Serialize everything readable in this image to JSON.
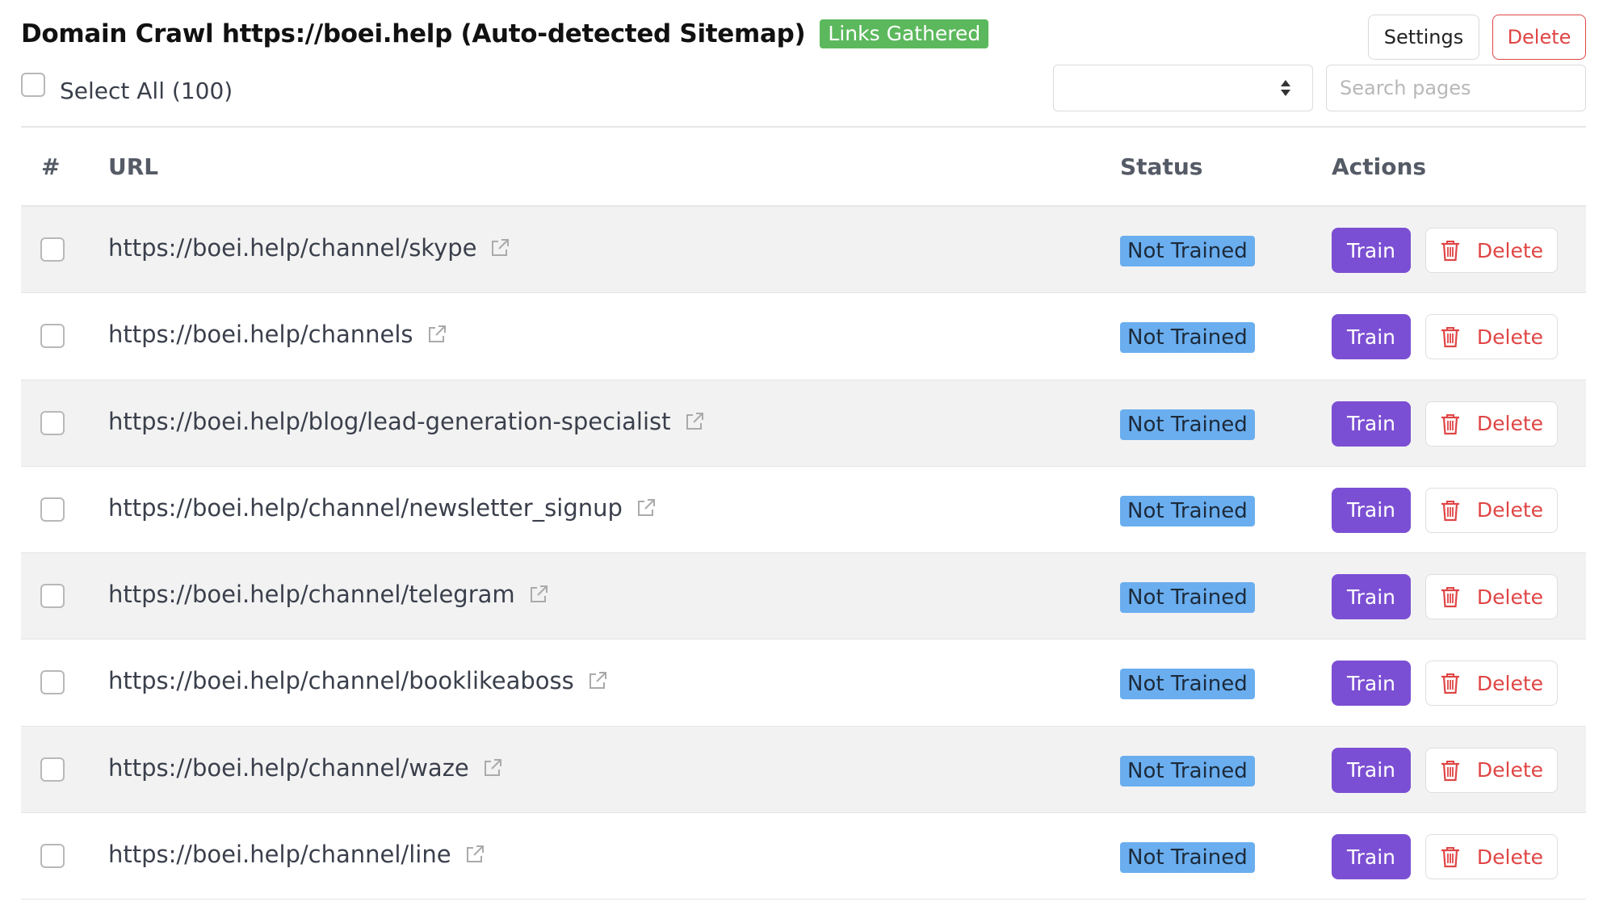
{
  "header": {
    "title": "Domain Crawl https://boei.help (Auto-detected Sitemap)",
    "status_badge": "Links Gathered",
    "settings_label": "Settings",
    "delete_label": "Delete",
    "select_all_label": "Select All (100)",
    "filter_value": "",
    "search_placeholder": "Search pages"
  },
  "table": {
    "columns": [
      "#",
      "URL",
      "Status",
      "Actions"
    ],
    "rows": [
      {
        "url": "https://boei.help/channel/skype",
        "status": "Not Trained",
        "train_label": "Train",
        "delete_label": "Delete"
      },
      {
        "url": "https://boei.help/channels",
        "status": "Not Trained",
        "train_label": "Train",
        "delete_label": "Delete"
      },
      {
        "url": "https://boei.help/blog/lead-generation-specialist",
        "status": "Not Trained",
        "train_label": "Train",
        "delete_label": "Delete"
      },
      {
        "url": "https://boei.help/channel/newsletter_signup",
        "status": "Not Trained",
        "train_label": "Train",
        "delete_label": "Delete"
      },
      {
        "url": "https://boei.help/channel/telegram",
        "status": "Not Trained",
        "train_label": "Train",
        "delete_label": "Delete"
      },
      {
        "url": "https://boei.help/channel/booklikeaboss",
        "status": "Not Trained",
        "train_label": "Train",
        "delete_label": "Delete"
      },
      {
        "url": "https://boei.help/channel/waze",
        "status": "Not Trained",
        "train_label": "Train",
        "delete_label": "Delete"
      },
      {
        "url": "https://boei.help/channel/line",
        "status": "Not Trained",
        "train_label": "Train",
        "delete_label": "Delete"
      }
    ]
  },
  "icons": {
    "external_link": "external-link-icon",
    "trash": "trash-icon",
    "sort": "sort-arrows-icon"
  },
  "colors": {
    "links_gathered_badge": "#5cb85c",
    "not_trained_badge": "#6aaeef",
    "train_button": "#7b4fd3",
    "delete_red": "#e04545",
    "striped_row": "#f2f2f2"
  }
}
